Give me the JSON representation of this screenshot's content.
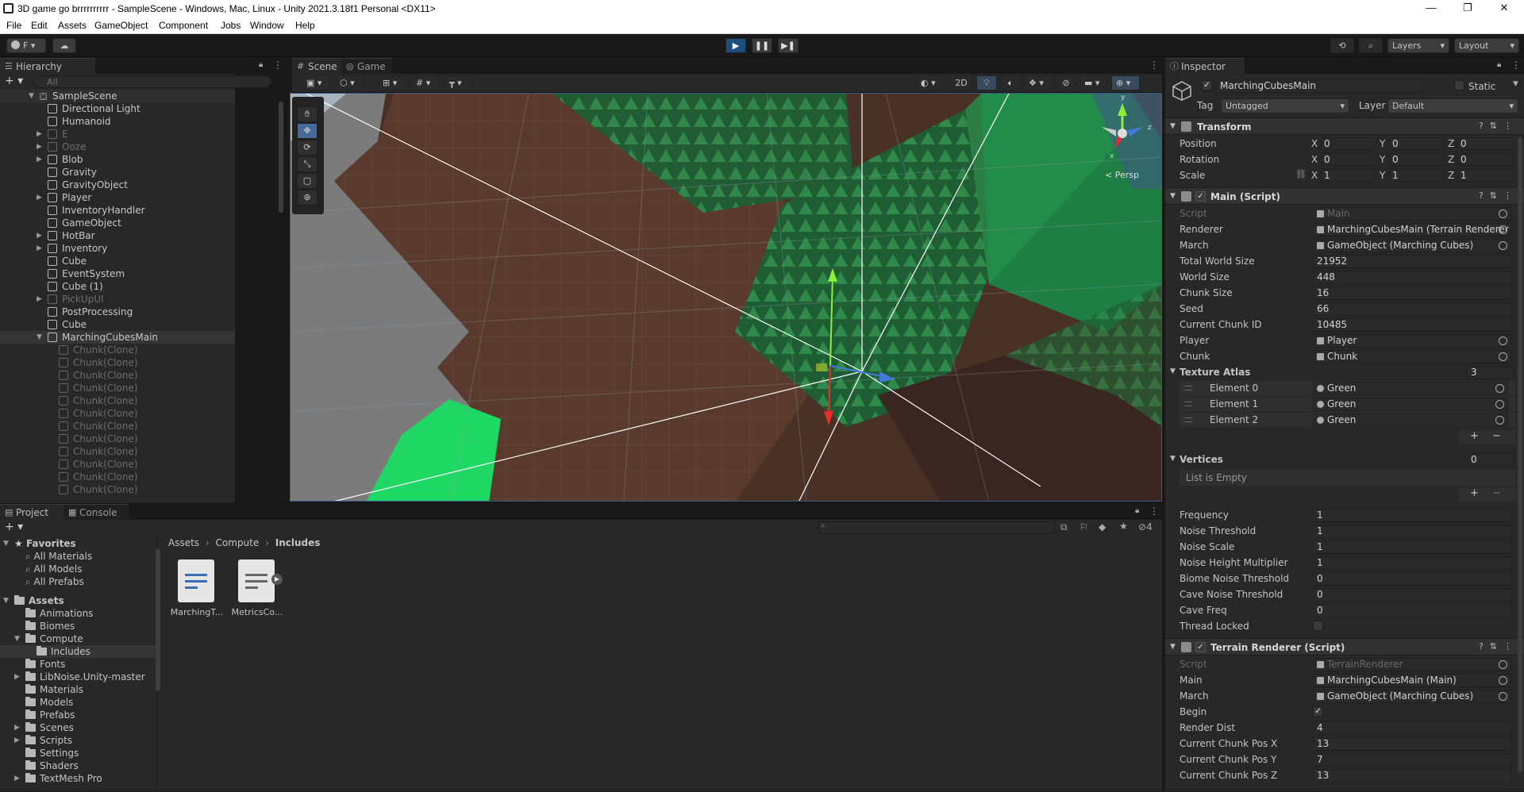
{
  "window": {
    "title": "3D game go brrrrrrrrrr - SampleScene - Windows, Mac, Linux - Unity 2021.3.18f1 Personal <DX11>",
    "controls": [
      "—",
      "❐",
      "✕"
    ]
  },
  "menu": [
    "File",
    "Edit",
    "Assets",
    "GameObject",
    "Component",
    "Jobs",
    "Window",
    "Help"
  ],
  "toolbar": {
    "account_label": "F",
    "layers_label": "Layers",
    "layout_label": "Layout"
  },
  "hierarchy": {
    "tab_label": "Hierarchy",
    "search_placeholder": "All",
    "scene_name": "SampleScene",
    "items": [
      {
        "label": "Directional Light",
        "dim": false,
        "expand": false,
        "indent": 1
      },
      {
        "label": "Humanoid",
        "dim": false,
        "expand": false,
        "indent": 1
      },
      {
        "label": "E",
        "dim": true,
        "expand": true,
        "indent": 1
      },
      {
        "label": "Ooze",
        "dim": true,
        "expand": true,
        "indent": 1
      },
      {
        "label": "Blob",
        "dim": false,
        "expand": true,
        "indent": 1
      },
      {
        "label": "Gravity",
        "dim": false,
        "expand": false,
        "indent": 1
      },
      {
        "label": "GravityObject",
        "dim": false,
        "expand": false,
        "indent": 1
      },
      {
        "label": "Player",
        "dim": false,
        "expand": true,
        "indent": 1
      },
      {
        "label": "InventoryHandler",
        "dim": false,
        "expand": false,
        "indent": 1
      },
      {
        "label": "GameObject",
        "dim": false,
        "expand": false,
        "indent": 1
      },
      {
        "label": "HotBar",
        "dim": false,
        "expand": true,
        "indent": 1
      },
      {
        "label": "Inventory",
        "dim": false,
        "expand": true,
        "indent": 1
      },
      {
        "label": "Cube",
        "dim": false,
        "expand": false,
        "indent": 1
      },
      {
        "label": "EventSystem",
        "dim": false,
        "expand": false,
        "indent": 1
      },
      {
        "label": "Cube (1)",
        "dim": false,
        "expand": false,
        "indent": 1
      },
      {
        "label": "PickUpUI",
        "dim": true,
        "expand": true,
        "indent": 1
      },
      {
        "label": "PostProcessing",
        "dim": false,
        "expand": false,
        "indent": 1
      },
      {
        "label": "Cube",
        "dim": false,
        "expand": false,
        "indent": 1
      },
      {
        "label": "MarchingCubesMain",
        "dim": false,
        "expand": true,
        "indent": 1,
        "selected": true,
        "open": true
      },
      {
        "label": "Chunk(Clone)",
        "dim": true,
        "expand": false,
        "indent": 2
      },
      {
        "label": "Chunk(Clone)",
        "dim": true,
        "expand": false,
        "indent": 2
      },
      {
        "label": "Chunk(Clone)",
        "dim": true,
        "expand": false,
        "indent": 2
      },
      {
        "label": "Chunk(Clone)",
        "dim": true,
        "expand": false,
        "indent": 2
      },
      {
        "label": "Chunk(Clone)",
        "dim": true,
        "expand": false,
        "indent": 2
      },
      {
        "label": "Chunk(Clone)",
        "dim": true,
        "expand": false,
        "indent": 2
      },
      {
        "label": "Chunk(Clone)",
        "dim": true,
        "expand": false,
        "indent": 2
      },
      {
        "label": "Chunk(Clone)",
        "dim": true,
        "expand": false,
        "indent": 2
      },
      {
        "label": "Chunk(Clone)",
        "dim": true,
        "expand": false,
        "indent": 2
      },
      {
        "label": "Chunk(Clone)",
        "dim": true,
        "expand": false,
        "indent": 2
      },
      {
        "label": "Chunk(Clone)",
        "dim": true,
        "expand": false,
        "indent": 2
      },
      {
        "label": "Chunk(Clone)",
        "dim": true,
        "expand": false,
        "indent": 2
      }
    ]
  },
  "scene": {
    "tabs": [
      "Scene",
      "Game"
    ],
    "mode_2d": "2D",
    "projection_label": "Persp",
    "gizmo_axes": [
      "y",
      "z",
      "x"
    ]
  },
  "inspector": {
    "tab_label": "Inspector",
    "object_name": "MarchingCubesMain",
    "static_label": "Static",
    "tag_label": "Tag",
    "tag_value": "Untagged",
    "layer_label": "Layer",
    "layer_value": "Default",
    "transform": {
      "title": "Transform",
      "rows": [
        {
          "label": "Position",
          "x": "0",
          "y": "0",
          "z": "0"
        },
        {
          "label": "Rotation",
          "x": "0",
          "y": "0",
          "z": "0"
        },
        {
          "label": "Scale",
          "x": "1",
          "y": "1",
          "z": "1"
        }
      ]
    },
    "main_script": {
      "title": "Main (Script)",
      "script_label": "Script",
      "script_value": "Main",
      "fields": [
        {
          "label": "Renderer",
          "value": "MarchingCubesMain (Terrain Renderer",
          "obj": true
        },
        {
          "label": "March",
          "value": "GameObject (Marching Cubes)",
          "obj": true
        },
        {
          "label": "Total World Size",
          "value": "21952"
        },
        {
          "label": "World Size",
          "value": "448"
        },
        {
          "label": "Chunk Size",
          "value": "16"
        },
        {
          "label": "Seed",
          "value": "66"
        },
        {
          "label": "Current Chunk ID",
          "value": "10485"
        },
        {
          "label": "Player",
          "value": "Player",
          "obj": true
        },
        {
          "label": "Chunk",
          "value": "Chunk",
          "obj": true
        }
      ],
      "texture_atlas": {
        "label": "Texture Atlas",
        "count": "3",
        "elements": [
          {
            "label": "Element 0",
            "value": "Green"
          },
          {
            "label": "Element 1",
            "value": "Green"
          },
          {
            "label": "Element 2",
            "value": "Green"
          }
        ]
      },
      "vertices": {
        "label": "Vertices",
        "count": "0",
        "empty_text": "List is Empty"
      },
      "fields2": [
        {
          "label": "Frequency",
          "value": "1"
        },
        {
          "label": "Noise Threshold",
          "value": "1"
        },
        {
          "label": "Noise Scale",
          "value": "1"
        },
        {
          "label": "Noise Height Multiplier",
          "value": "1"
        },
        {
          "label": "Biome Noise Threshold",
          "value": "0"
        },
        {
          "label": "Cave Noise Threshold",
          "value": "0"
        },
        {
          "label": "Cave Freq",
          "value": "0"
        }
      ],
      "thread_locked_label": "Thread Locked"
    },
    "terrain_renderer": {
      "title": "Terrain Renderer (Script)",
      "script_label": "Script",
      "script_value": "TerrainRenderer",
      "fields": [
        {
          "label": "Main",
          "value": "MarchingCubesMain (Main)",
          "obj": true
        },
        {
          "label": "March",
          "value": "GameObject (Marching Cubes)",
          "obj": true
        }
      ],
      "begin_label": "Begin",
      "fields2": [
        {
          "label": "Render Dist",
          "value": "4"
        },
        {
          "label": "Current Chunk Pos X",
          "value": "13"
        },
        {
          "label": "Current Chunk Pos Y",
          "value": "7"
        },
        {
          "label": "Current Chunk Pos Z",
          "value": "13"
        }
      ]
    }
  },
  "project": {
    "tabs": [
      "Project",
      "Console"
    ],
    "hidden_count": "4",
    "breadcrumb": [
      "Assets",
      "Compute",
      "Includes"
    ],
    "favorites_label": "Favorites",
    "favorites": [
      "All Materials",
      "All Models",
      "All Prefabs"
    ],
    "assets_label": "Assets",
    "folders": [
      {
        "label": "Animations",
        "indent": 1
      },
      {
        "label": "Biomes",
        "indent": 1
      },
      {
        "label": "Compute",
        "indent": 1,
        "open": true
      },
      {
        "label": "Includes",
        "indent": 2,
        "selected": true
      },
      {
        "label": "Fonts",
        "indent": 1
      },
      {
        "label": "LibNoise.Unity-master",
        "indent": 1,
        "expand": true
      },
      {
        "label": "Materials",
        "indent": 1
      },
      {
        "label": "Models",
        "indent": 1
      },
      {
        "label": "Prefabs",
        "indent": 1
      },
      {
        "label": "Scenes",
        "indent": 1,
        "expand": true
      },
      {
        "label": "Scripts",
        "indent": 1,
        "expand": true
      },
      {
        "label": "Settings",
        "indent": 1
      },
      {
        "label": "Shaders",
        "indent": 1
      },
      {
        "label": "TextMesh Pro",
        "indent": 1,
        "expand": true
      }
    ],
    "files": [
      {
        "label": "MarchingT...",
        "type": "compute"
      },
      {
        "label": "MetricsCo...",
        "type": "script"
      }
    ]
  }
}
